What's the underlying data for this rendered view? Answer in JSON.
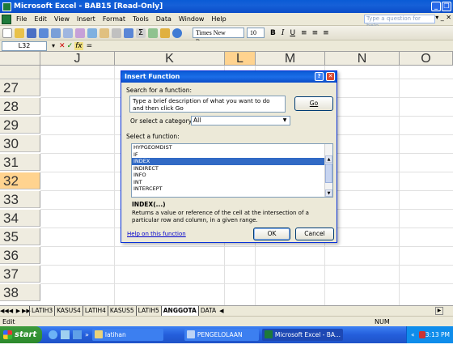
{
  "window": {
    "title": "Microsoft Excel - BAB15 [Read-Only]"
  },
  "menu": [
    "File",
    "Edit",
    "View",
    "Insert",
    "Format",
    "Tools",
    "Data",
    "Window",
    "Help"
  ],
  "help_placeholder": "Type a question for help",
  "toolbar": {
    "font_name": "Times New Roman",
    "font_size": "10"
  },
  "formula_bar": {
    "name_box": "L32",
    "content": "="
  },
  "columns": [
    "J",
    "K",
    "L",
    "M",
    "N",
    "O"
  ],
  "rows": [
    "27",
    "28",
    "29",
    "30",
    "31",
    "32",
    "33",
    "34",
    "35",
    "36",
    "37",
    "38"
  ],
  "selected_row": "32",
  "dialog": {
    "title": "Insert Function",
    "search_label": "Search for a function:",
    "search_text": "Type a brief description of what you want to do and then click Go",
    "go_label": "Go",
    "category_label": "Or select a category:",
    "category_value": "All",
    "function_label": "Select a function:",
    "functions": [
      "HYPGEOMDIST",
      "IF",
      "INDEX",
      "INDIRECT",
      "INFO",
      "INT",
      "INTERCEPT"
    ],
    "selected_function": "INDEX",
    "signature": "INDEX(...)",
    "description": "Returns a value or reference of the cell at the intersection of a particular row and column, in a given range.",
    "help_link": "Help on this function",
    "ok_label": "OK",
    "cancel_label": "Cancel"
  },
  "sheet_tabs": [
    "LATIH3",
    "KASUS4",
    "LATIH4",
    "KASUS5",
    "LATIH5",
    "ANGGOTA",
    "DATA"
  ],
  "active_sheet": "ANGGOTA",
  "status": {
    "mode": "Edit",
    "num": "NUM"
  },
  "taskbar": {
    "start": "start",
    "items": [
      "latihan",
      "PENGELOLAAN SIMP...",
      "Microsoft Excel - BA..."
    ],
    "active_item": "Microsoft Excel - BA...",
    "clock": "3:13 PM"
  }
}
